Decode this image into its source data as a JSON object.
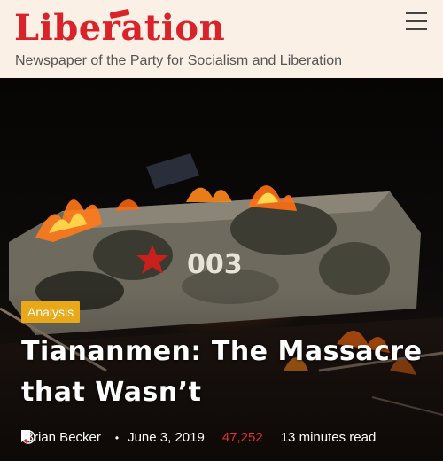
{
  "header": {
    "logo_text": "Liberation",
    "tagline": "Newspaper of the Party for Socialism and Liberation",
    "menu_icon": "hamburger-menu-icon"
  },
  "article": {
    "category": "Analysis",
    "title": "Tiananmen: The Massacre that Wasn’t",
    "author": "Brian Becker",
    "date": "June 3, 2019",
    "views": "47,252",
    "read_time": "13 minutes read",
    "hero_number": "003"
  },
  "colors": {
    "brand_red": "#d8232a",
    "header_bg": "#faf0e6",
    "badge": "#e8a817",
    "views": "#e0322a"
  }
}
